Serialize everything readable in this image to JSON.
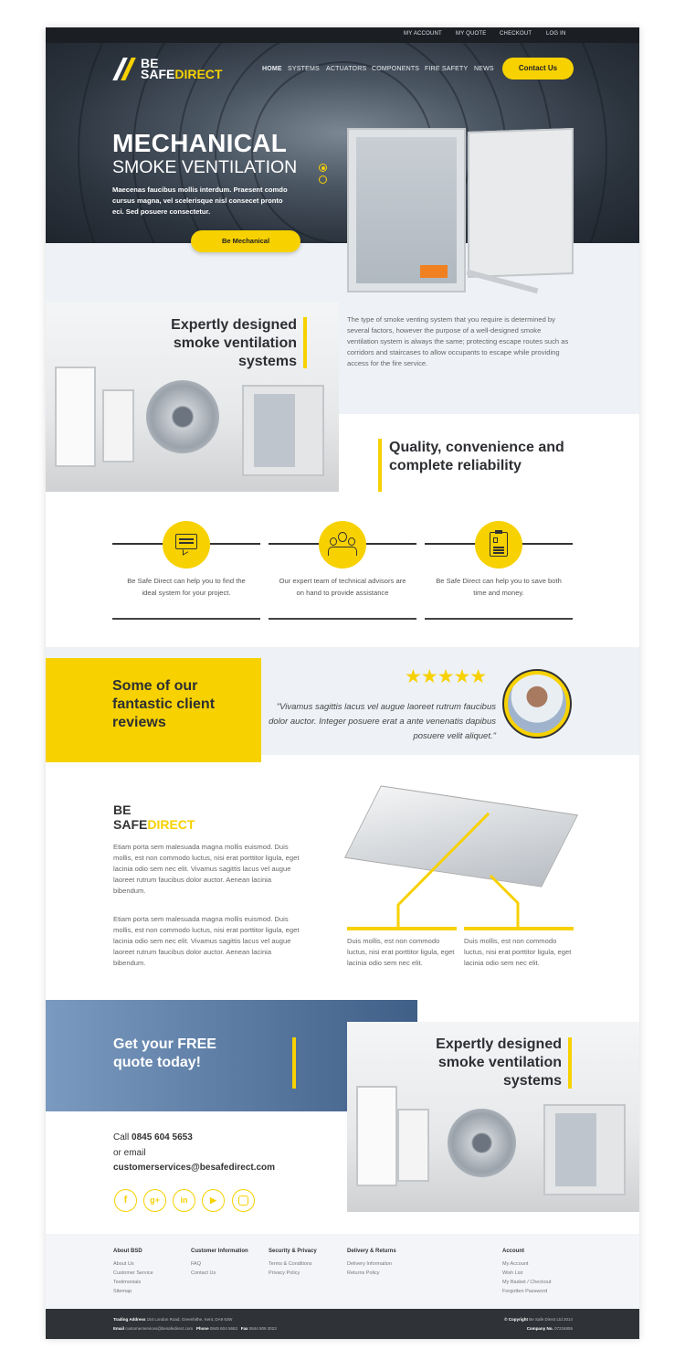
{
  "topbar": {
    "links": [
      "MY ACCOUNT",
      "MY QUOTE",
      "CHECKOUT",
      "LOG IN"
    ]
  },
  "brand": {
    "line1": "BE",
    "line2a": "SAFE",
    "line2b": "DIRECT"
  },
  "nav": {
    "items": [
      "HOME",
      "SYSTEMS",
      "ACTUATORS",
      "COMPONENTS",
      "FIRE SAFETY",
      "NEWS"
    ],
    "active": "HOME",
    "contact": "Contact Us"
  },
  "hero": {
    "title": "MECHANICAL",
    "subtitle": "SMOKE VENTILATION",
    "text": "Maecenas faucibus mollis interdum. Praesent comdo cursus magna, vel scelerisque nisl consecet pronto eci. Sed posuere consectetur.",
    "cta": "Be Mechanical",
    "slides": 2,
    "active_slide": 1
  },
  "intro": {
    "heading": "Expertly designed smoke ventilation systems",
    "text": "The type of smoke venting system that you require is determined by several factors, however the purpose of a well-designed smoke ventilation system is always the same; protecting escape routes such as corridors and staircases to allow occupants to escape while providing access for the fire service.",
    "quality_heading": "Quality, convenience and complete reliability"
  },
  "features": [
    {
      "icon": "chat-document-icon",
      "text": "Be Safe Direct can help you to find the ideal system for your project."
    },
    {
      "icon": "team-icon",
      "text": "Our expert team of technical advisors are on hand to provide assistance"
    },
    {
      "icon": "clipboard-icon",
      "text": "Be Safe Direct can help you to save both time and money."
    }
  ],
  "reviews": {
    "heading": "Some of our fantastic client reviews",
    "rating": 5,
    "quote": "\"Vivamus sagittis lacus vel augue laoreet rutrum faucibus dolor auctor. Integer posuere erat a ante venenatis dapibus posuere velit aliquet.\""
  },
  "about": {
    "para1": "Etiam porta sem malesuada magna mollis euismod. Duis mollis, est non commodo luctus, nisi erat porttitor ligula, eget lacinia odio sem nec elit. Vivamus sagittis lacus vel augue laoreet rutrum faucibus dolor auctor. Aenean lacinia bibendum.",
    "para2": "Etiam porta sem malesuada magna mollis euismod. Duis mollis, est non commodo luctus, nisi erat porttitor ligula, eget lacinia odio sem nec elit. Vivamus sagittis lacus vel augue laoreet rutrum faucibus dolor auctor. Aenean lacinia bibendum.",
    "callout1": "Duis mollis, est non commodo luctus, nisi erat porttitor ligula, eget lacinia odio sem nec elit.",
    "callout2": "Duis mollis, est non commodo luctus, nisi erat porttitor ligula, eget lacinia odio sem nec elit."
  },
  "quote": {
    "heading": "Get your FREE quote today!",
    "call_label": "Call",
    "phone": "0845 604 5653",
    "email_label": "or email",
    "email": "customerservices@besafedirect.com",
    "image_heading": "Expertly designed smoke ventilation systems",
    "social": [
      "facebook-icon",
      "google-plus-icon",
      "linkedin-icon",
      "youtube-icon",
      "instagram-icon"
    ]
  },
  "footer": {
    "columns": [
      {
        "title": "About BSD",
        "links": [
          "About Us",
          "Customer Service",
          "Testimonials",
          "Sitemap"
        ]
      },
      {
        "title": "Customer Information",
        "links": [
          "FAQ",
          "Contact Us"
        ]
      },
      {
        "title": "Security & Privacy",
        "links": [
          "Terms & Conditions",
          "Privacy Policy"
        ]
      },
      {
        "title": "Delivery & Returns",
        "links": [
          "Delivery Information",
          "Returns Policy"
        ]
      },
      {
        "title": "Account",
        "links": [
          "My Account",
          "Wish List",
          "My Basket / Checkout",
          "Forgotten Password"
        ]
      }
    ],
    "address_label": "Trading Address",
    "address": "154 London Road, Greenhithe, Kent, DA9 9JW",
    "email_label": "Email",
    "email": "customerservices@besafedirect.com",
    "phone_label": "Phone",
    "phone": "0845 604 5653",
    "fax_label": "Fax",
    "fax": "0844 809 3023",
    "copyright_label": "© Copyright",
    "copyright": "Be Safe Direct Ltd 2014",
    "company_label": "Company No.",
    "company": "07234855"
  },
  "colors": {
    "accent": "#f7d100",
    "dark": "#1b1f24",
    "light_bg": "#eef2f6",
    "footer_dark": "#2f3337"
  }
}
